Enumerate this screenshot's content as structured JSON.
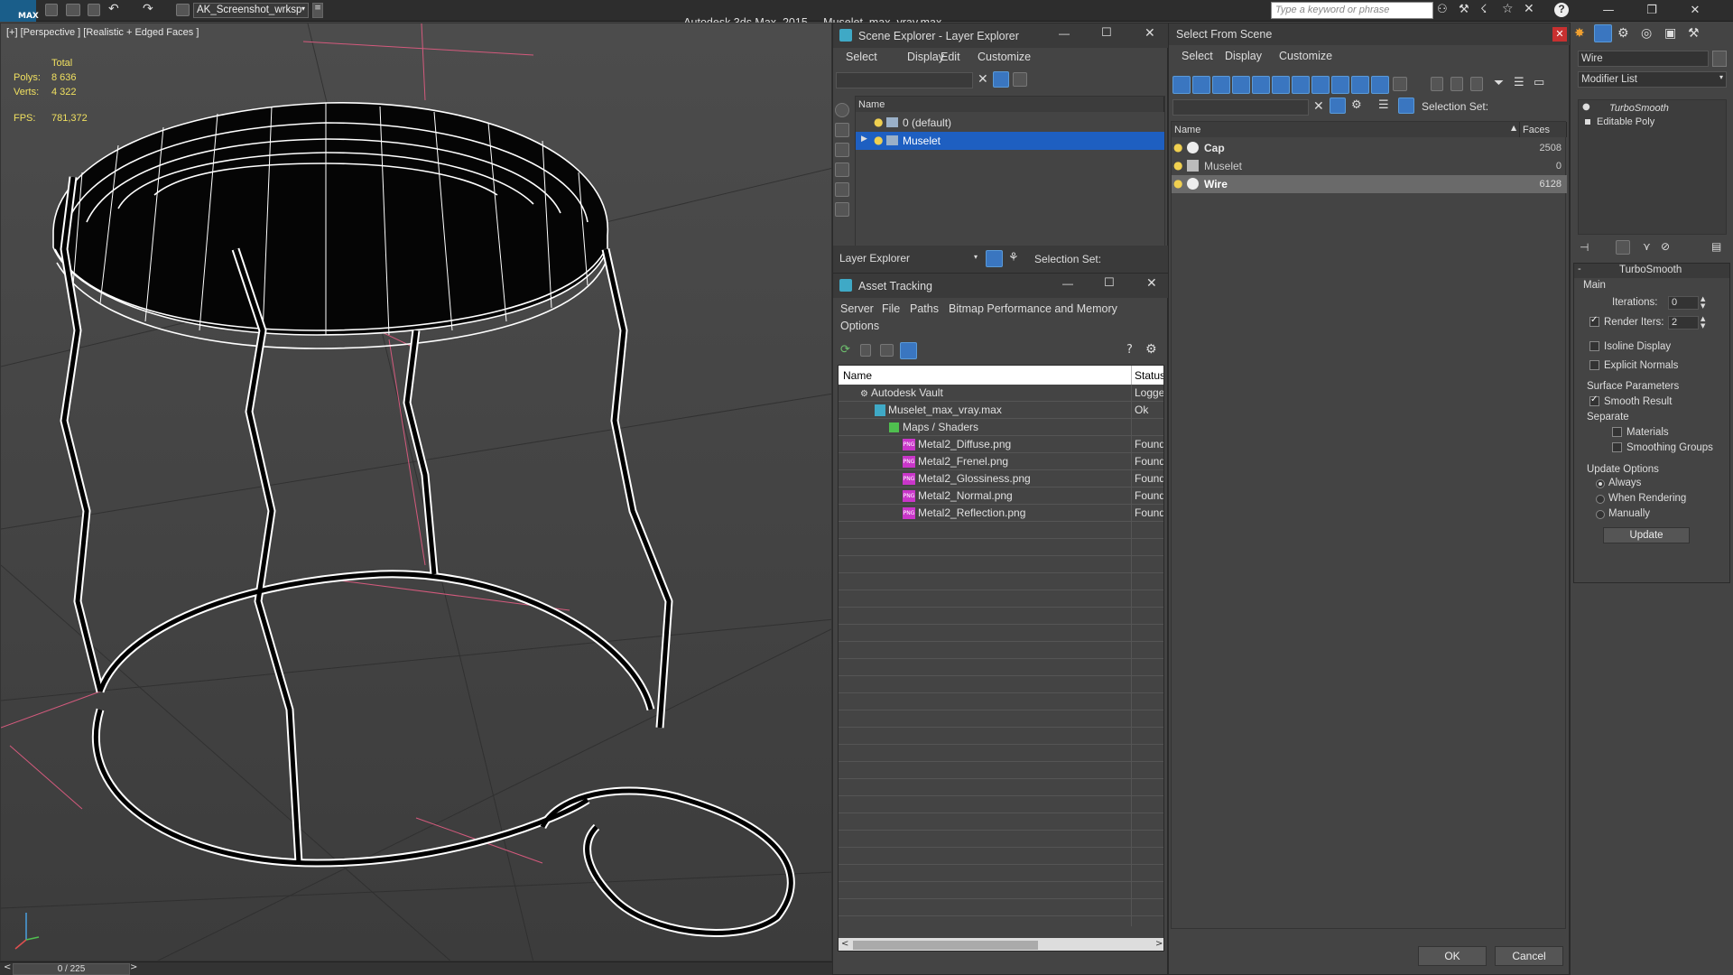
{
  "app": {
    "title": "Autodesk 3ds Max  2015",
    "file": "Muselet_max_vray.max",
    "workspace": "AK_Screenshot_wrksp",
    "search_placeholder": "Type a keyword or phrase",
    "logo": "MAX"
  },
  "viewport": {
    "label": "[+] [Perspective ] [Realistic + Edged Faces ]",
    "stats": {
      "total_label": "Total",
      "polys_label": "Polys:",
      "polys_value": "8 636",
      "verts_label": "Verts:",
      "verts_value": "4 322",
      "fps_label": "FPS:",
      "fps_value": "781,372"
    },
    "timeline": "0 / 225"
  },
  "scene_explorer": {
    "title": "Scene Explorer - Layer Explorer",
    "menu": [
      "Select",
      "Display",
      "Edit",
      "Customize"
    ],
    "column": "Name",
    "rows": [
      {
        "name": "0 (default)",
        "selected": false
      },
      {
        "name": "Muselet",
        "selected": true
      }
    ],
    "footer_dropdown": "Layer Explorer",
    "selection_set_label": "Selection Set:"
  },
  "asset_tracking": {
    "title": "Asset Tracking",
    "menu": [
      "Server",
      "File",
      "Paths",
      "Bitmap Performance and Memory"
    ],
    "menu2": "Options",
    "col_name": "Name",
    "col_status": "Status",
    "rows": [
      {
        "name": "Autodesk Vault",
        "status": "Logged",
        "indent": 1,
        "kind": "vault"
      },
      {
        "name": "Muselet_max_vray.max",
        "status": "Ok",
        "indent": 2,
        "kind": "max"
      },
      {
        "name": "Maps / Shaders",
        "status": "",
        "indent": 3,
        "kind": "maps"
      },
      {
        "name": "Metal2_Diffuse.png",
        "status": "Found",
        "indent": 4,
        "kind": "png"
      },
      {
        "name": "Metal2_Frenel.png",
        "status": "Found",
        "indent": 4,
        "kind": "png"
      },
      {
        "name": "Metal2_Glossiness.png",
        "status": "Found",
        "indent": 4,
        "kind": "png"
      },
      {
        "name": "Metal2_Normal.png",
        "status": "Found",
        "indent": 4,
        "kind": "png"
      },
      {
        "name": "Metal2_Reflection.png",
        "status": "Found",
        "indent": 4,
        "kind": "png"
      }
    ],
    "png_badge": "PNG"
  },
  "select_from_scene": {
    "title": "Select From Scene",
    "menu": [
      "Select",
      "Display",
      "Customize"
    ],
    "selection_set_label": "Selection Set:",
    "col_name": "Name",
    "col_faces": "Faces",
    "rows": [
      {
        "name": "Cap",
        "faces": "2508",
        "bold": true,
        "selected": false
      },
      {
        "name": "Muselet",
        "faces": "0",
        "bold": false,
        "selected": false
      },
      {
        "name": "Wire",
        "faces": "6128",
        "bold": true,
        "selected": true
      }
    ],
    "ok": "OK",
    "cancel": "Cancel"
  },
  "command_panel": {
    "object_name": "Wire",
    "modifier_list": "Modifier List",
    "stack": [
      "TurboSmooth",
      "Editable Poly"
    ],
    "rollout_title": "TurboSmooth",
    "main_group": "Main",
    "iterations_label": "Iterations:",
    "iterations_value": "0",
    "render_iters_label": "Render Iters:",
    "render_iters_value": "2",
    "render_iters_checked": true,
    "isoline_label": "Isoline Display",
    "explicit_normals_label": "Explicit Normals",
    "surface_group": "Surface Parameters",
    "smooth_result_label": "Smooth Result",
    "separate_label": "Separate",
    "materials_label": "Materials",
    "smoothing_groups_label": "Smoothing Groups",
    "update_group": "Update Options",
    "always_label": "Always",
    "when_rendering_label": "When Rendering",
    "manually_label": "Manually",
    "update_button": "Update"
  }
}
